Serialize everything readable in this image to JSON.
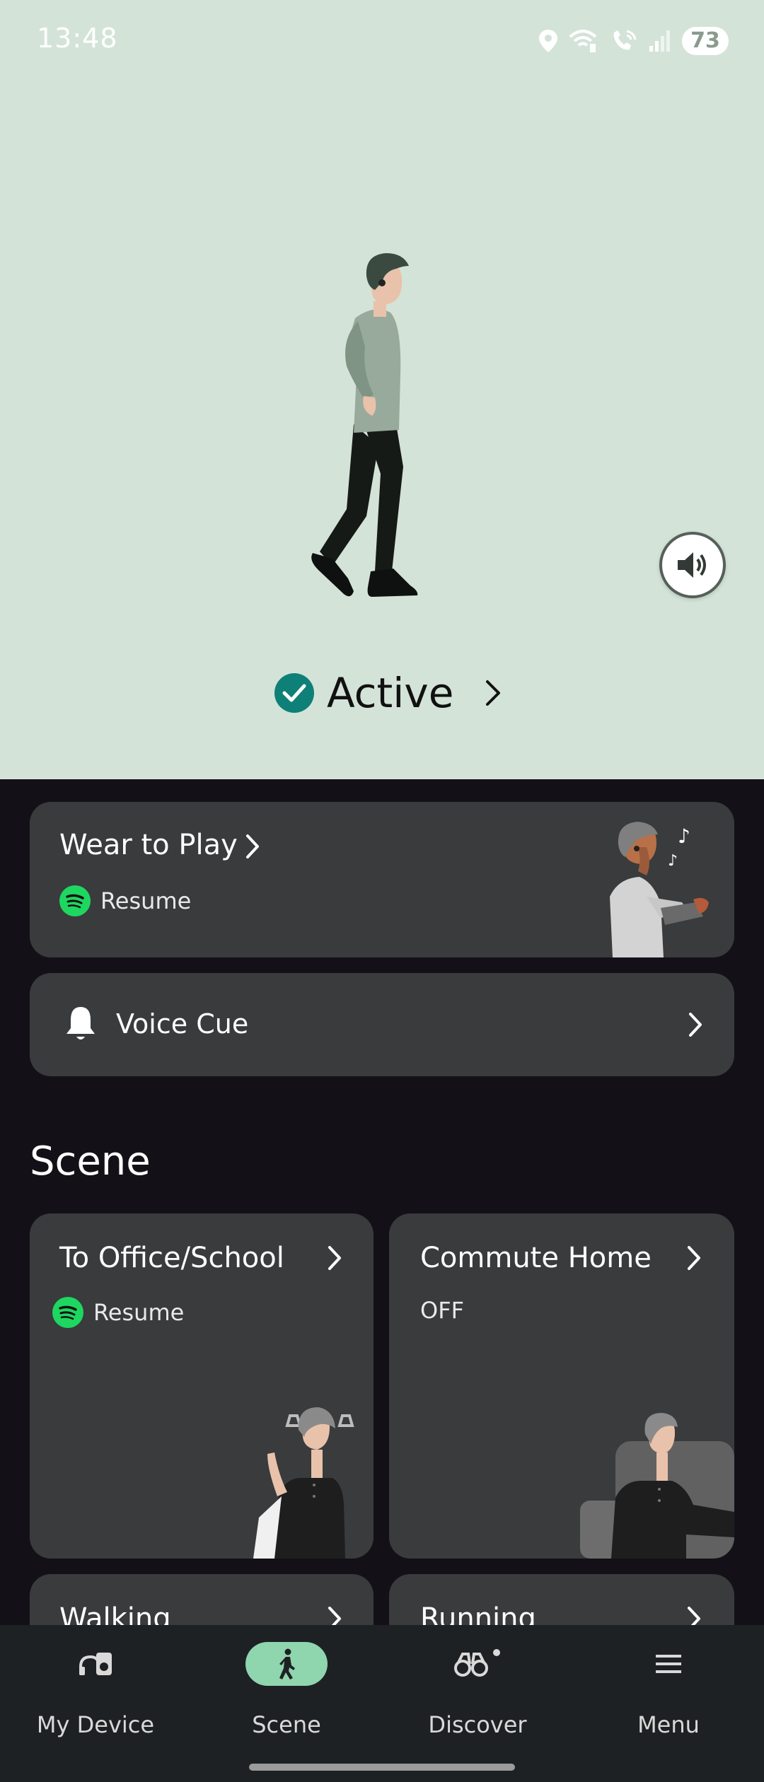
{
  "status_bar": {
    "time": "13:48",
    "battery": "73",
    "icons": [
      "location-icon",
      "wifi-calling-icon",
      "volte-call-icon",
      "signal-icon",
      "battery-icon"
    ]
  },
  "hero": {
    "background_color": "#d4e3d8",
    "status_label": "Active",
    "sound_button_icon": "speaker-icon"
  },
  "cards": {
    "wear_to_play": {
      "title": "Wear to Play",
      "sub_label": "Resume",
      "sub_icon": "spotify-icon"
    },
    "voice_cue": {
      "title": "Voice Cue",
      "icon": "bell-icon"
    }
  },
  "scene": {
    "heading": "Scene",
    "items": [
      {
        "title": "To Office/School",
        "sub_label": "Resume",
        "sub_icon": "spotify-icon"
      },
      {
        "title": "Commute Home",
        "sub_label": "OFF"
      },
      {
        "title": "Walking"
      },
      {
        "title": "Running"
      }
    ]
  },
  "nav": {
    "items": [
      {
        "label": "My Device",
        "icon": "device-icon",
        "selected": false
      },
      {
        "label": "Scene",
        "icon": "walking-icon",
        "selected": true
      },
      {
        "label": "Discover",
        "icon": "binoculars-icon",
        "selected": false
      },
      {
        "label": "Menu",
        "icon": "hamburger-icon",
        "selected": false
      }
    ]
  },
  "colors": {
    "accent": "#0f8078",
    "nav_selected": "#8fd6ae",
    "card_bg": "#393b3d",
    "spotify": "#1ed760"
  }
}
